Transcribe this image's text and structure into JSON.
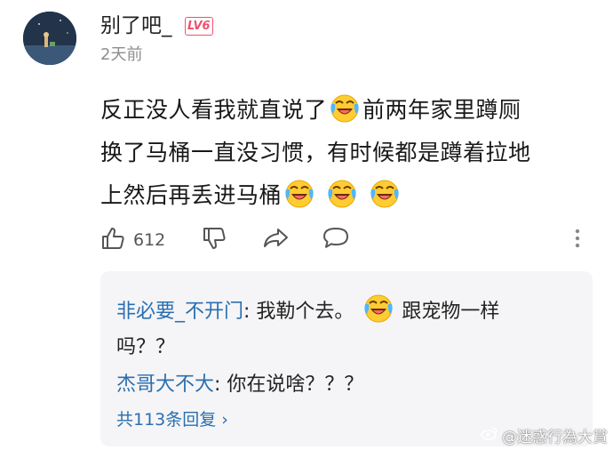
{
  "comment": {
    "username": "别了吧_",
    "level_badge": "LV6",
    "timestamp": "2天前",
    "text_lines": [
      "反正没人看我就直说了",
      "前两年家里蹲厕",
      "换了马桶一直没习惯，有时候都是蹲着拉地",
      "上然后再丢进马桶"
    ],
    "emoji_icon": "laughing-tears-emoji",
    "like_count": "612"
  },
  "replies": {
    "items": [
      {
        "name": "非必要_不开门",
        "text_a": ": 我勒个去。",
        "text_b": "跟宠物一样",
        "text_c": "吗？？"
      },
      {
        "name": "杰哥大不大",
        "text": ": 你在说啥？？？"
      }
    ],
    "more_label": "共113条回复 ›"
  },
  "watermark": "@迷惑行為大賞",
  "colors": {
    "link": "#2a6fb0",
    "badge": "#f0506e",
    "reply_bg": "#f5f5f7"
  }
}
